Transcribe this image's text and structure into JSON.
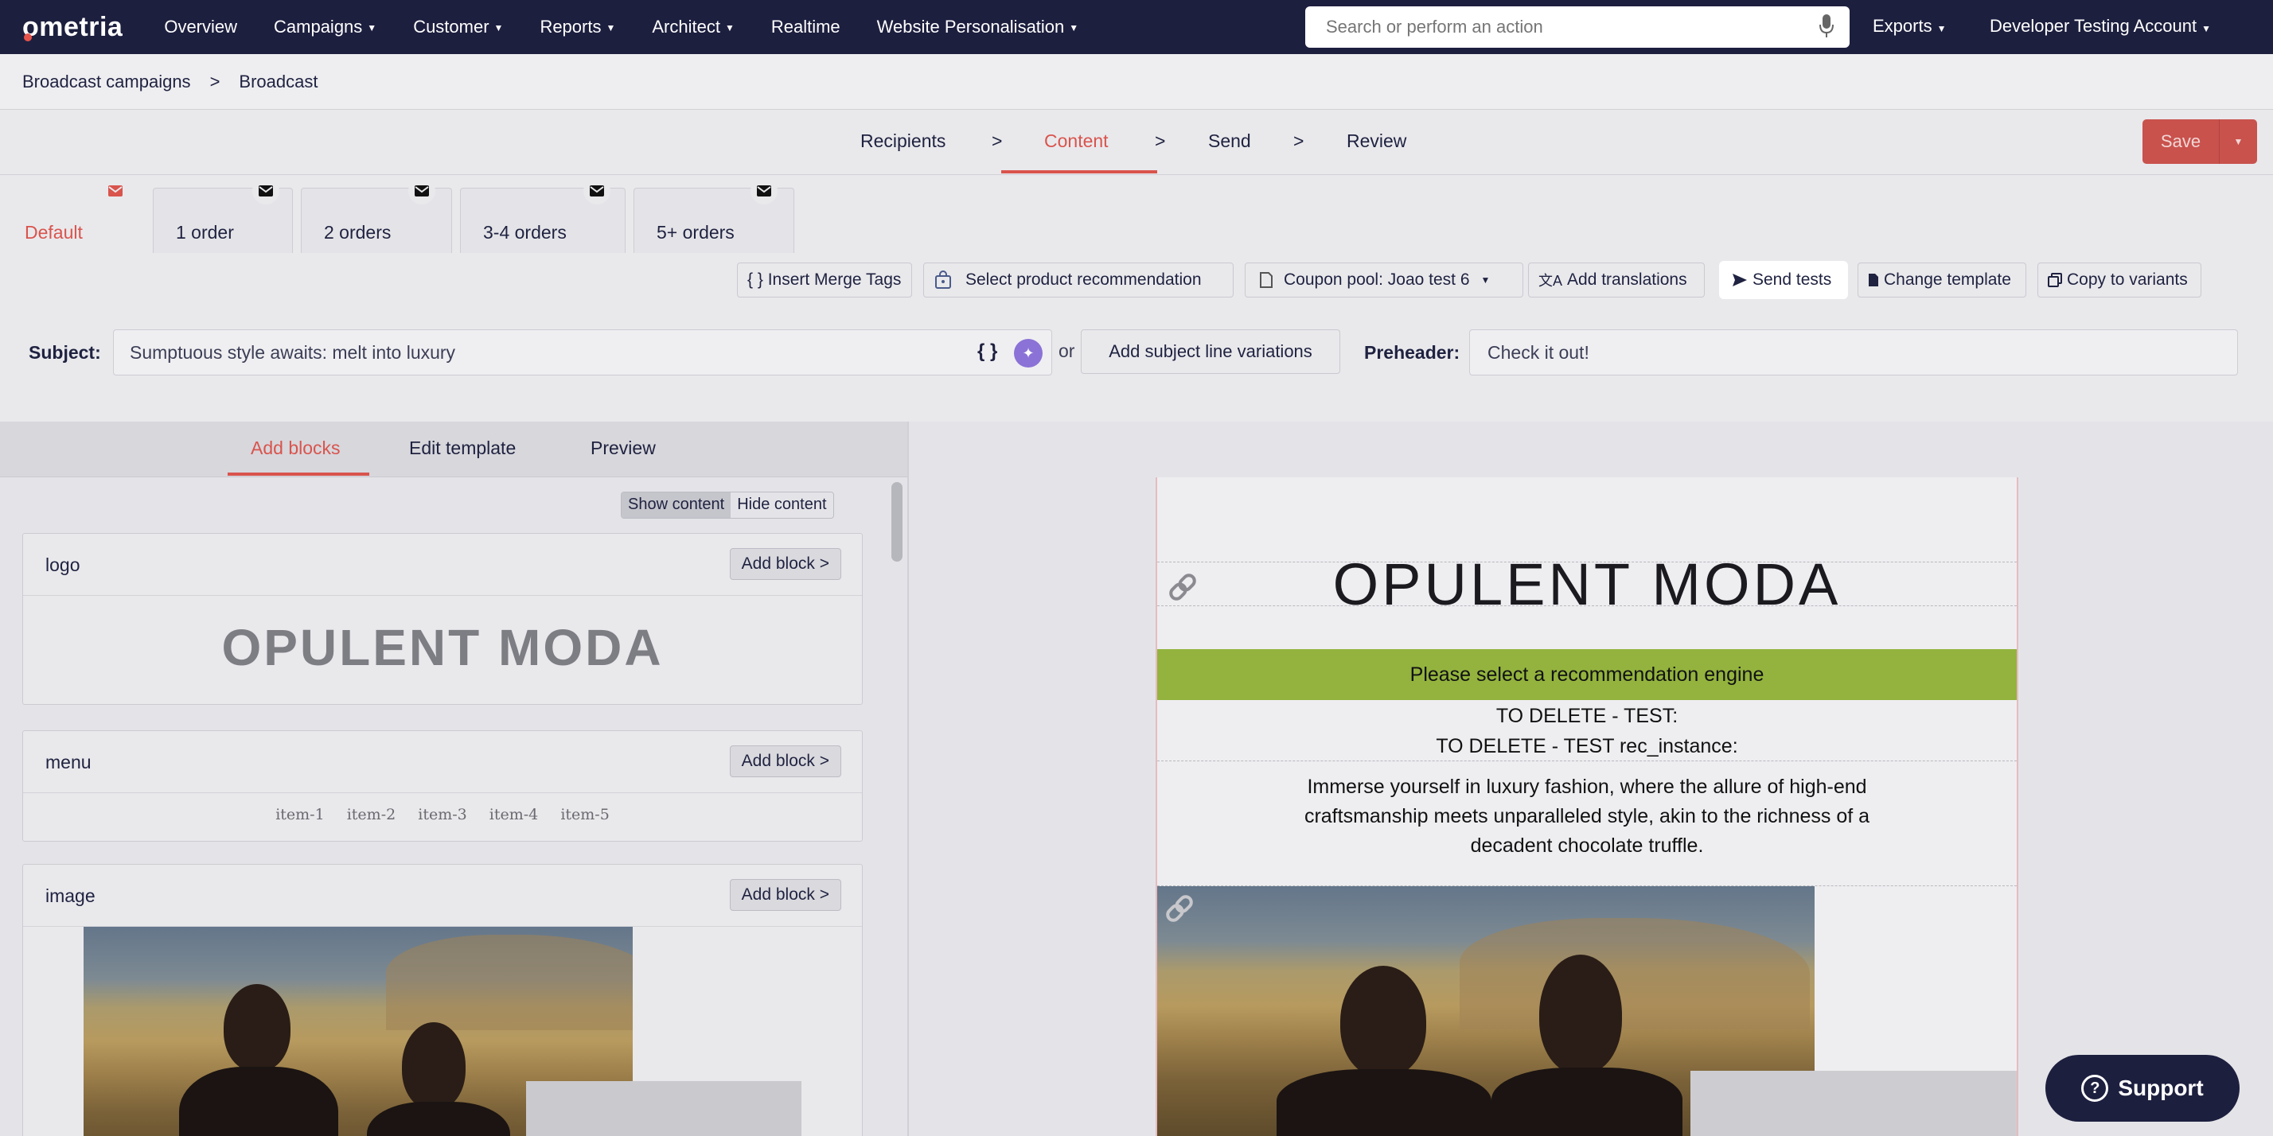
{
  "nav": {
    "logo": "ometria",
    "items": [
      {
        "label": "Overview",
        "caret": false
      },
      {
        "label": "Campaigns",
        "caret": true
      },
      {
        "label": "Customer",
        "caret": true
      },
      {
        "label": "Reports",
        "caret": true
      },
      {
        "label": "Architect",
        "caret": true
      },
      {
        "label": "Realtime",
        "caret": false
      },
      {
        "label": "Website Personalisation",
        "caret": true
      }
    ],
    "search_placeholder": "Search or perform an action",
    "exports": "Exports",
    "account": "Developer Testing Account"
  },
  "breadcrumb": {
    "items": [
      "Broadcast campaigns",
      "Broadcast"
    ],
    "separator": ">"
  },
  "steps": {
    "items": [
      "Recipients",
      "Content",
      "Send",
      "Review"
    ],
    "active": "Content",
    "separator": ">"
  },
  "save": {
    "label": "Save"
  },
  "variant_tabs": [
    "Default",
    "1 order",
    "2 orders",
    "3-4 orders",
    "5+ orders"
  ],
  "toolbar": {
    "insert_merge_tags": "{ } Insert Merge Tags",
    "select_product": "Select product recommendation",
    "coupon_pool": "Coupon pool: Joao test 6",
    "add_translations": "Add translations",
    "send_tests": "Send tests",
    "change_template": "Change template",
    "copy_to_variants": "Copy to variants"
  },
  "subject": {
    "label": "Subject:",
    "value": "Sumptuous style awaits: melt into luxury",
    "merge_glyph": "{ }",
    "or": "or",
    "variations_button": "Add subject line variations"
  },
  "preheader": {
    "label": "Preheader:",
    "value": "Check it out!"
  },
  "left_tabs": {
    "items": [
      "Add blocks",
      "Edit template",
      "Preview"
    ],
    "active": "Add blocks"
  },
  "content_toggle": {
    "show": "Show content",
    "hide": "Hide content"
  },
  "blocks": [
    {
      "title": "logo",
      "button": "Add block >",
      "preview": "OPULENT MODA"
    },
    {
      "title": "menu",
      "button": "Add block >",
      "items": [
        "item-1",
        "item-2",
        "item-3",
        "item-4",
        "item-5"
      ]
    },
    {
      "title": "image",
      "button": "Add block >"
    }
  ],
  "email": {
    "logo_text": "OPULENT MODA",
    "recommendation_notice": "Please select a recommendation engine",
    "todelete_1": "TO DELETE - TEST:",
    "todelete_2": "TO DELETE - TEST rec_instance:",
    "description": "Immerse yourself in luxury fashion, where the allure of high-end craftsmanship meets unparalleled style, akin to the richness of a decadent chocolate truffle."
  },
  "support": {
    "label": "Support"
  },
  "colors": {
    "navy": "#1d1f3f",
    "accent": "#d9544d",
    "reco_green": "#93b33e",
    "ai_purple": "#8b72d6"
  }
}
